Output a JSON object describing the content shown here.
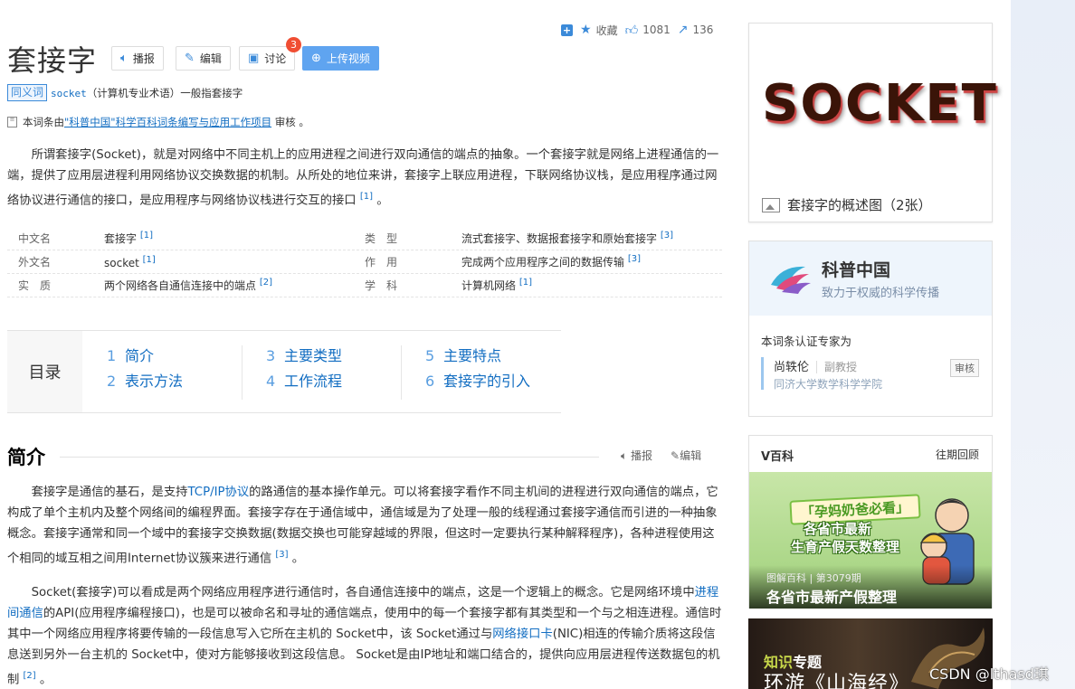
{
  "topbar": {
    "collect_label": "收藏",
    "like_count": "1081",
    "share_count": "136"
  },
  "header": {
    "title": "套接字",
    "buttons": {
      "play": "播报",
      "edit": "编辑",
      "discuss": "讨论",
      "upload": "上传视频"
    },
    "discuss_badge": "3"
  },
  "synonym": {
    "tag": "同义词",
    "term": "socket",
    "rest": "（计算机专业术语）一般指套接字"
  },
  "review": {
    "prefix": "本词条由",
    "link": "\"科普中国\"科学百科词条编写与应用工作项目",
    "suffix": " 审核 。"
  },
  "intro": {
    "text": "所谓套接字(Socket)，就是对网络中不同主机上的应用进程之间进行双向通信的端点的抽象。一个套接字就是网络上进程通信的一端，提供了应用层进程利用网络协议交换数据的机制。从所处的地位来讲，套接字上联应用进程，下联网络协议栈，是应用程序通过网络协议进行通信的接口，是应用程序与网络协议栈进行交互的接口",
    "ref": "[1]",
    "tail": " 。"
  },
  "info": {
    "rows": [
      {
        "k1": "中文名",
        "v1": "套接字",
        "r1": "[1]",
        "k2": "类　型",
        "v2": "流式套接字、数据报套接字和原始套接字",
        "r2": "[3]"
      },
      {
        "k1": "外文名",
        "v1": "socket",
        "r1": "[1]",
        "k2": "作　用",
        "v2": "完成两个应用程序之间的数据传输",
        "r2": "[3]"
      },
      {
        "k1": "实　质",
        "v1": "两个网络各自通信连接中的端点",
        "r1": "[2]",
        "k2": "学　科",
        "v2": "计算机网络",
        "r2": "[1]"
      }
    ]
  },
  "catalog": {
    "label": "目录",
    "items": [
      {
        "n": "1",
        "label": "简介"
      },
      {
        "n": "2",
        "label": "表示方法"
      },
      {
        "n": "3",
        "label": "主要类型"
      },
      {
        "n": "4",
        "label": "工作流程"
      },
      {
        "n": "5",
        "label": "主要特点"
      },
      {
        "n": "6",
        "label": "套接字的引入"
      }
    ]
  },
  "section": {
    "title": "简介",
    "play": "播报",
    "edit": "编辑"
  },
  "body": {
    "p1_a": "套接字是通信的基石，是支持",
    "p1_link": "TCP/IP协议",
    "p1_b": "的路通信的基本操作单元。可以将套接字看作不同主机间的进程进行双向通信的端点，它构成了单个主机内及整个网络间的编程界面。套接字存在于通信域中，通信域是为了处理一般的线程通过套接字通信而引进的一种抽象概念。套接字通常和同一个域中的套接字交换数据(数据交换也可能穿越域的界限，但这时一定要执行某种解释程序)，各种进程使用这个相同的域互相之间用Internet协议簇来进行通信",
    "p1_ref": "[3]",
    "p1_tail": " 。",
    "p2_a": "Socket(套接字)可以看成是两个网络应用程序进行通信时，各自通信连接中的端点，这是一个逻辑上的概念。它是网络环境中",
    "p2_link1": "进程间通信",
    "p2_b": "的API(应用程序编程接口)，也是可以被命名和寻址的通信端点，使用中的每一个套接字都有其类型和一个与之相连进程。通信时其中一个网络应用程序将要传输的一段信息写入它所在主机的 Socket中，该 Socket通过与",
    "p2_link2": "网络接口卡",
    "p2_c": "(NIC)相连的传输介质将这段信息送到另外一台主机的 Socket中，使对方能够接收到这段信息。 Socket是由IP地址和端口结合的，提供向应用层进程传送数据包的机制",
    "p2_ref": "[2]",
    "p2_tail": " 。"
  },
  "sidebar": {
    "image_word": "SOCKET",
    "image_caption": "套接字的概述图（2张）",
    "kepu": {
      "name": "科普中国",
      "slogan": "致力于权威的科学传播",
      "cert": "本词条认证专家为",
      "expert": "尚轶伦",
      "expert_title": "副教授",
      "org": "同济大学数学科学学院",
      "review": "审核"
    },
    "vbaike": {
      "title": "V百科",
      "more": "往期回顾",
      "banner1": "「孕妈奶爸必看」",
      "banner2": "各省市最新",
      "banner3": "生育产假天数整理",
      "issue": "图解百科 | 第3079期",
      "caption": "各省市最新产假整理"
    },
    "zhishi": {
      "tag_a": "知识",
      "tag_b": "专题",
      "title": "环游《山海经》"
    }
  },
  "watermark": "CSDN @lthasd琪",
  "colors": {
    "link": "#136ec2",
    "accent": "#3b8ad9",
    "badge": "#f04e33"
  }
}
